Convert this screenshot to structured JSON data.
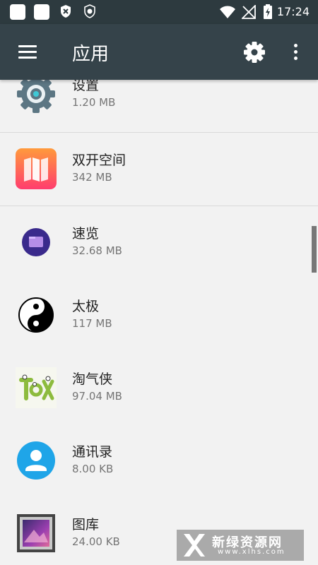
{
  "status_bar": {
    "time": "17:24",
    "icons": [
      "app-notification-icon",
      "app-notification-icon",
      "shield-x-icon",
      "shield-v-icon",
      "wifi-icon",
      "no-signal-icon",
      "battery-charging-icon"
    ]
  },
  "toolbar": {
    "title": "应用",
    "menu_icon": "menu-icon",
    "settings_icon": "gear-icon",
    "more_icon": "more-vert-icon"
  },
  "apps": [
    {
      "name": "设置",
      "size": "1.20 MB",
      "icon": "gear-icon"
    },
    {
      "name": "双开空间",
      "size": "342 MB",
      "icon": "dual-space-icon"
    },
    {
      "name": "速览",
      "size": "32.68 MB",
      "icon": "quick-view-icon"
    },
    {
      "name": "太极",
      "size": "117 MB",
      "icon": "yin-yang-icon"
    },
    {
      "name": "淘气侠",
      "size": "97.04 MB",
      "icon": "taoqixia-icon"
    },
    {
      "name": "通讯录",
      "size": "8.00 KB",
      "icon": "contacts-icon"
    },
    {
      "name": "图库",
      "size": "24.00 KB",
      "icon": "gallery-icon"
    }
  ],
  "watermark": {
    "title": "新绿资源网",
    "subtitle": "www.xlhs.com"
  },
  "colors": {
    "status_bar": "#2d3a3f",
    "toolbar": "#35434a",
    "background": "#f2f2f2"
  }
}
